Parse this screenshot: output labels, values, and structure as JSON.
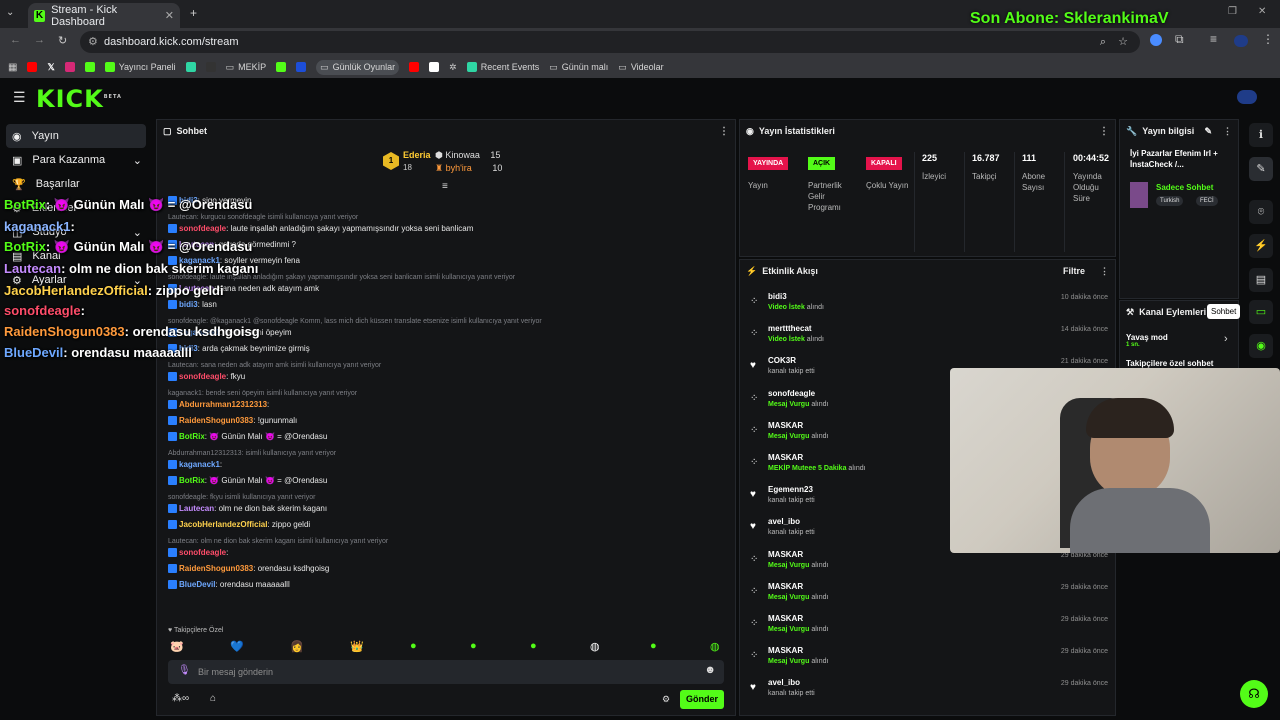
{
  "browser": {
    "tab_title": "Stream - Kick Dashboard",
    "url": "dashboard.kick.com/stream",
    "bookmarks": [
      "Yayıncı Paneli",
      "MEKİP",
      "Günlük Oyunlar",
      "Recent Events",
      "Günün malı",
      "Videolar"
    ]
  },
  "stream_overlay": {
    "banner": "Son Abone: SklerankimaV",
    "chat": [
      {
        "user": "BotRix",
        "color": "#53fc18",
        "text": ": 😈 Günün Malı 😈 = @Orendasu"
      },
      {
        "user": "kaganack1",
        "color": "#8ab4ff",
        "text": ":"
      },
      {
        "user": "BotRix",
        "color": "#53fc18",
        "text": ": 😈 Günün Malı 😈 = @Orendasu"
      },
      {
        "user": "Lautecan",
        "color": "#c58cff",
        "text": ": olm ne dion bak skerim kaganı"
      },
      {
        "user": "JacobHerlandezOfficial",
        "color": "#ffd24d",
        "text": ": zippo geldi"
      },
      {
        "user": "sonofdeagle",
        "color": "#ff4d6a",
        "text": ":"
      },
      {
        "user": "RaidenShogun0383",
        "color": "#ff9a3c",
        "text": ": orendasu ksdhgoisg"
      },
      {
        "user": "BlueDevil",
        "color": "#6ea8ff",
        "text": ": orendasu maaaaalll"
      }
    ]
  },
  "kick": {
    "logo": "KICK",
    "beta": "BETA"
  },
  "sidebar": {
    "items": [
      {
        "label": "Yayın",
        "active": true
      },
      {
        "label": "Para Kazanma"
      },
      {
        "label": "Başarılar"
      },
      {
        "label": "Eklentiler"
      },
      {
        "label": "Stüdyo"
      },
      {
        "label": "Kanal"
      },
      {
        "label": "Ayarlar"
      }
    ]
  },
  "chat_panel": {
    "title": "Sohbet",
    "leaderboard": [
      {
        "rank": "1",
        "name": "Ederia",
        "count": "18"
      },
      {
        "name": "Kinowaa",
        "count": "15"
      },
      {
        "name": "byh'ira",
        "count": "10"
      }
    ],
    "messages": [
      {
        "user": "bidi3",
        "color": "#6ea8ff",
        "text": ": sigo vermeyin",
        "reply": ""
      },
      {
        "reply": "Lautecan: kurgucu sonofdeagle isimli kullanıcıya yanıt veriyor"
      },
      {
        "user": "sonofdeagle",
        "color": "#ff4d6a",
        "text": ": laute inşallah anladığım şakayı yapmamışsındır yoksa seni banlicam"
      },
      {
        "user": "Lautecan",
        "color": "#c58cff",
        "text": ": gogoda görmedinmi ?"
      },
      {
        "user": "kaganack1",
        "color": "#6ea8ff",
        "text": ": soyller vermeyin fena"
      },
      {
        "reply": "sonofdeagle: laute inşallah anladığım şakayı yapmamışsındır yoksa seni banlicam isimli kullanıcıya yanıt veriyor"
      },
      {
        "user": "Lautecan",
        "color": "#c58cff",
        "text": ": sana neden adk atayım amk"
      },
      {
        "user": "bidi3",
        "color": "#6ea8ff",
        "text": ": lasn"
      },
      {
        "reply": "sonofdeagle: @kaganack1 @sonofdeagle Komm, lass mich dich küssen translate etsenize isimli kullanıcıya yanıt veriyor"
      },
      {
        "user": "kaganack1",
        "color": "#6ea8ff",
        "text": ": bende seni öpeyim"
      },
      {
        "user": "bidi3",
        "color": "#6ea8ff",
        "text": ": arda çakmak beynimize girmiş"
      },
      {
        "reply": "Lautecan: sana neden adk atayım amk isimli kullanıcıya yanıt veriyor"
      },
      {
        "user": "sonofdeagle",
        "color": "#ff4d6a",
        "text": ": fkyu"
      },
      {
        "reply": "kaganack1: bende seni öpeyim isimli kullanıcıya yanıt veriyor"
      },
      {
        "user": "Abdurrahman12312313",
        "color": "#ff9a3c",
        "text": ":"
      },
      {
        "user": "RaidenShogun0383",
        "color": "#ff9a3c",
        "text": ": !gununmalı"
      },
      {
        "user": "BotRix",
        "color": "#53fc18",
        "text": ": 😈 Günün Malı 😈 = @Orendasu"
      },
      {
        "reply": "Abdurrahman12312313: isimli kullanıcıya yanıt veriyor"
      },
      {
        "user": "kaganack1",
        "color": "#6ea8ff",
        "text": ":"
      },
      {
        "user": "BotRix",
        "color": "#53fc18",
        "text": ": 😈 Günün Malı 😈 = @Orendasu"
      },
      {
        "reply": "sonofdeagle: fkyu isimli kullanıcıya yanıt veriyor"
      },
      {
        "user": "Lautecan",
        "color": "#c58cff",
        "text": ": olm ne dion bak skerim kaganı"
      },
      {
        "user": "JacobHerlandezOfficial",
        "color": "#ffd24d",
        "text": ": zippo geldi"
      },
      {
        "reply": "Lautecan: olm ne dion bak skerim kaganı isimli kullanıcıya yanıt veriyor"
      },
      {
        "user": "sonofdeagle",
        "color": "#ff4d6a",
        "text": ":"
      },
      {
        "user": "RaidenShogun0383",
        "color": "#ff9a3c",
        "text": ": orendasu ksdhgoisg"
      },
      {
        "user": "BlueDevil",
        "color": "#6ea8ff",
        "text": ": orendasu maaaaalll"
      }
    ],
    "followers_only": "Takipçilere Özel",
    "input_placeholder": "Bir mesaj gönderin",
    "send_label": "Gönder"
  },
  "stats_panel": {
    "title": "Yayın İstatistikleri",
    "tags": [
      {
        "tag": "YAYINDA",
        "label": "Yayın",
        "color": "#e5134b"
      },
      {
        "tag": "AÇIK",
        "label": "Partnerlik Gelir Programı",
        "color": "#53fc18"
      },
      {
        "tag": "KAPALI",
        "label": "Çoklu Yayın",
        "color": "#e5134b"
      }
    ],
    "stats": [
      {
        "value": "225",
        "label": "İzleyici"
      },
      {
        "value": "16.787",
        "label": "Takipçi"
      },
      {
        "value": "111",
        "label": "Abone Sayısı"
      },
      {
        "value": "00:44:52",
        "label": "Yayında Olduğu Süre"
      }
    ]
  },
  "events_panel": {
    "title": "Etkinlik Akışı",
    "filter": "Filtre",
    "events": [
      {
        "name": "bidi3",
        "hl": "Video İstek",
        "rest": "alındı",
        "time": "10 dakika önce",
        "icon": "dot"
      },
      {
        "name": "merttthecat",
        "hl": "Video İstek",
        "rest": "alındı",
        "time": "14 dakika önce",
        "icon": "dot"
      },
      {
        "name": "COK3R",
        "hl": "",
        "rest": "kanalı takip etti",
        "time": "21 dakika önce",
        "icon": "heart"
      },
      {
        "name": "sonofdeagle",
        "hl": "Mesaj Vurgu",
        "rest": "alındı",
        "time": "",
        "icon": "dot"
      },
      {
        "name": "MASKAR",
        "hl": "Mesaj Vurgu",
        "rest": "alındı",
        "time": "",
        "icon": "dot"
      },
      {
        "name": "MASKAR",
        "hl": "MEKİP Muteee 5 Dakika",
        "rest": "alındı",
        "time": "",
        "icon": "dot"
      },
      {
        "name": "Egemenn23",
        "hl": "",
        "rest": "kanalı takip etti",
        "time": "",
        "icon": "heart"
      },
      {
        "name": "avel_ibo",
        "hl": "",
        "rest": "kanalı takip etti",
        "time": "",
        "icon": "heart"
      },
      {
        "name": "MASKAR",
        "hl": "Mesaj Vurgu",
        "rest": "alındı",
        "time": "29 dakika önce",
        "icon": "dot"
      },
      {
        "name": "MASKAR",
        "hl": "Mesaj Vurgu",
        "rest": "alındı",
        "time": "29 dakika önce",
        "icon": "dot"
      },
      {
        "name": "MASKAR",
        "hl": "Mesaj Vurgu",
        "rest": "alındı",
        "time": "29 dakika önce",
        "icon": "dot"
      },
      {
        "name": "MASKAR",
        "hl": "Mesaj Vurgu",
        "rest": "alındı",
        "time": "29 dakika önce",
        "icon": "dot"
      },
      {
        "name": "avel_ibo",
        "hl": "",
        "rest": "kanalı takip etti",
        "time": "29 dakika önce",
        "icon": "heart"
      }
    ]
  },
  "info_panel": {
    "title": "Yayın bilgisi",
    "stream_title": "İyi Pazarlar Efenim Irl + İnstaCheck /...",
    "category": "Sadece Sohbet",
    "tags": [
      "Turkish",
      "FECİ"
    ]
  },
  "channel_actions": {
    "title": "Kanal Eylemleri",
    "tooltip": "Sohbet",
    "items": [
      {
        "label": "Yavaş mod",
        "sub": "1 sn."
      },
      {
        "label": "Takipçilere özel sohbet",
        "sub": ""
      }
    ]
  }
}
